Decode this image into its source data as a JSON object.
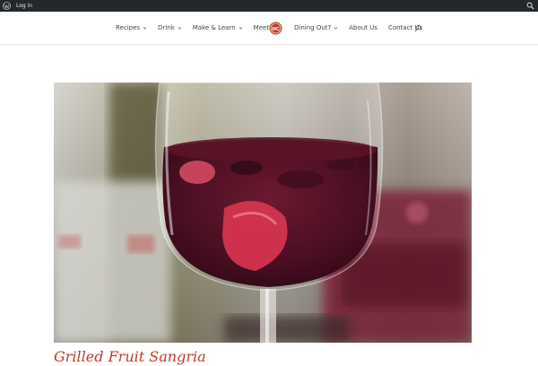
{
  "admin_bar": {
    "login_label": "Log in",
    "icons": [
      "wordpress-logo-icon",
      "search-icon"
    ]
  },
  "nav": {
    "left_items": [
      {
        "label": "Recipes",
        "has_dropdown": true
      },
      {
        "label": "Drink",
        "has_dropdown": true
      },
      {
        "label": "Make & Learn",
        "has_dropdown": true
      },
      {
        "label": "Meet",
        "has_dropdown": true
      }
    ],
    "logo_text": "MC",
    "right_items": [
      {
        "label": "Dining Out?",
        "has_dropdown": true
      },
      {
        "label": "About Us",
        "has_dropdown": false
      },
      {
        "label": "Contact Us",
        "has_dropdown": false
      }
    ],
    "search_icon": "search-icon"
  },
  "hero": {
    "image_subject": "glass of red sangria with fruit"
  },
  "post": {
    "title_partial": "Grilled Fruit Sangria"
  },
  "colors": {
    "admin_bar_bg": "#23282d",
    "brand_red": "#c0392b",
    "nav_text": "#444444"
  }
}
